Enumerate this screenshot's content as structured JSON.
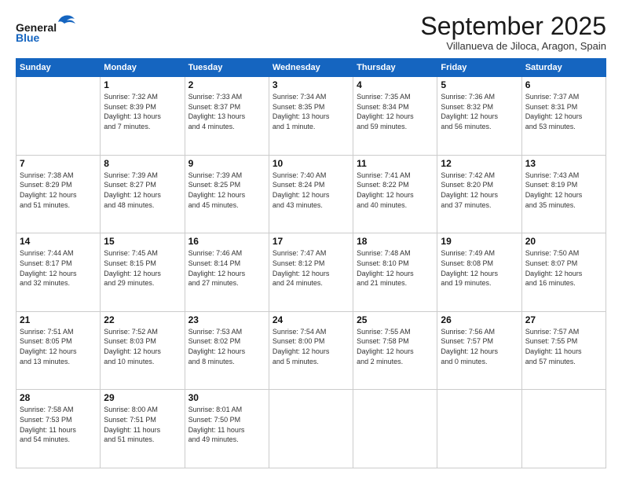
{
  "logo": {
    "line1": "General",
    "line2": "Blue"
  },
  "title": "September 2025",
  "subtitle": "Villanueva de Jiloca, Aragon, Spain",
  "header_days": [
    "Sunday",
    "Monday",
    "Tuesday",
    "Wednesday",
    "Thursday",
    "Friday",
    "Saturday"
  ],
  "weeks": [
    [
      {
        "day": "",
        "info": ""
      },
      {
        "day": "1",
        "info": "Sunrise: 7:32 AM\nSunset: 8:39 PM\nDaylight: 13 hours\nand 7 minutes."
      },
      {
        "day": "2",
        "info": "Sunrise: 7:33 AM\nSunset: 8:37 PM\nDaylight: 13 hours\nand 4 minutes."
      },
      {
        "day": "3",
        "info": "Sunrise: 7:34 AM\nSunset: 8:35 PM\nDaylight: 13 hours\nand 1 minute."
      },
      {
        "day": "4",
        "info": "Sunrise: 7:35 AM\nSunset: 8:34 PM\nDaylight: 12 hours\nand 59 minutes."
      },
      {
        "day": "5",
        "info": "Sunrise: 7:36 AM\nSunset: 8:32 PM\nDaylight: 12 hours\nand 56 minutes."
      },
      {
        "day": "6",
        "info": "Sunrise: 7:37 AM\nSunset: 8:31 PM\nDaylight: 12 hours\nand 53 minutes."
      }
    ],
    [
      {
        "day": "7",
        "info": "Sunrise: 7:38 AM\nSunset: 8:29 PM\nDaylight: 12 hours\nand 51 minutes."
      },
      {
        "day": "8",
        "info": "Sunrise: 7:39 AM\nSunset: 8:27 PM\nDaylight: 12 hours\nand 48 minutes."
      },
      {
        "day": "9",
        "info": "Sunrise: 7:39 AM\nSunset: 8:25 PM\nDaylight: 12 hours\nand 45 minutes."
      },
      {
        "day": "10",
        "info": "Sunrise: 7:40 AM\nSunset: 8:24 PM\nDaylight: 12 hours\nand 43 minutes."
      },
      {
        "day": "11",
        "info": "Sunrise: 7:41 AM\nSunset: 8:22 PM\nDaylight: 12 hours\nand 40 minutes."
      },
      {
        "day": "12",
        "info": "Sunrise: 7:42 AM\nSunset: 8:20 PM\nDaylight: 12 hours\nand 37 minutes."
      },
      {
        "day": "13",
        "info": "Sunrise: 7:43 AM\nSunset: 8:19 PM\nDaylight: 12 hours\nand 35 minutes."
      }
    ],
    [
      {
        "day": "14",
        "info": "Sunrise: 7:44 AM\nSunset: 8:17 PM\nDaylight: 12 hours\nand 32 minutes."
      },
      {
        "day": "15",
        "info": "Sunrise: 7:45 AM\nSunset: 8:15 PM\nDaylight: 12 hours\nand 29 minutes."
      },
      {
        "day": "16",
        "info": "Sunrise: 7:46 AM\nSunset: 8:14 PM\nDaylight: 12 hours\nand 27 minutes."
      },
      {
        "day": "17",
        "info": "Sunrise: 7:47 AM\nSunset: 8:12 PM\nDaylight: 12 hours\nand 24 minutes."
      },
      {
        "day": "18",
        "info": "Sunrise: 7:48 AM\nSunset: 8:10 PM\nDaylight: 12 hours\nand 21 minutes."
      },
      {
        "day": "19",
        "info": "Sunrise: 7:49 AM\nSunset: 8:08 PM\nDaylight: 12 hours\nand 19 minutes."
      },
      {
        "day": "20",
        "info": "Sunrise: 7:50 AM\nSunset: 8:07 PM\nDaylight: 12 hours\nand 16 minutes."
      }
    ],
    [
      {
        "day": "21",
        "info": "Sunrise: 7:51 AM\nSunset: 8:05 PM\nDaylight: 12 hours\nand 13 minutes."
      },
      {
        "day": "22",
        "info": "Sunrise: 7:52 AM\nSunset: 8:03 PM\nDaylight: 12 hours\nand 10 minutes."
      },
      {
        "day": "23",
        "info": "Sunrise: 7:53 AM\nSunset: 8:02 PM\nDaylight: 12 hours\nand 8 minutes."
      },
      {
        "day": "24",
        "info": "Sunrise: 7:54 AM\nSunset: 8:00 PM\nDaylight: 12 hours\nand 5 minutes."
      },
      {
        "day": "25",
        "info": "Sunrise: 7:55 AM\nSunset: 7:58 PM\nDaylight: 12 hours\nand 2 minutes."
      },
      {
        "day": "26",
        "info": "Sunrise: 7:56 AM\nSunset: 7:57 PM\nDaylight: 12 hours\nand 0 minutes."
      },
      {
        "day": "27",
        "info": "Sunrise: 7:57 AM\nSunset: 7:55 PM\nDaylight: 11 hours\nand 57 minutes."
      }
    ],
    [
      {
        "day": "28",
        "info": "Sunrise: 7:58 AM\nSunset: 7:53 PM\nDaylight: 11 hours\nand 54 minutes."
      },
      {
        "day": "29",
        "info": "Sunrise: 8:00 AM\nSunset: 7:51 PM\nDaylight: 11 hours\nand 51 minutes."
      },
      {
        "day": "30",
        "info": "Sunrise: 8:01 AM\nSunset: 7:50 PM\nDaylight: 11 hours\nand 49 minutes."
      },
      {
        "day": "",
        "info": ""
      },
      {
        "day": "",
        "info": ""
      },
      {
        "day": "",
        "info": ""
      },
      {
        "day": "",
        "info": ""
      }
    ]
  ]
}
